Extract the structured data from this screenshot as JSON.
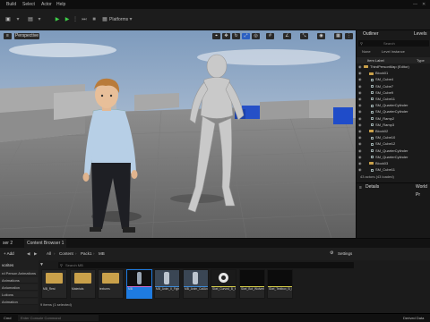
{
  "menu": {
    "items": [
      "Build",
      "Select",
      "Actor",
      "Help"
    ]
  },
  "toolbar": {
    "platforms_label": "Platforms"
  },
  "viewport": {
    "label": "Perspective"
  },
  "outliner": {
    "tab_outliner": "Outliner",
    "tab_levels": "Levels",
    "search_placeholder": "Search",
    "col_item_label": "Item Label",
    "col_type": "Type",
    "filter_none": "None",
    "filter_level": "Level Instance",
    "rows": [
      "ThirdPersonMap (Editor)",
      "Block01",
      "SM_Cube4",
      "SM_Cube7",
      "SM_Cube9",
      "SM_Cube11",
      "SM_QuarterCylinder",
      "SM_QuarterCylinder",
      "SM_Ramp2",
      "SM_Ramp3",
      "Block02",
      "SM_Cube10",
      "SM_Cube12",
      "SM_QuarterCylinder",
      "SM_QuarterCylinder",
      "Block03",
      "SM_Cube11"
    ],
    "status": "43 actors (43 loaded)"
  },
  "details": {
    "tab_details": "Details",
    "tab_world": "World Pr"
  },
  "content_browser": {
    "tab_drawer": "ser 2",
    "tab_main": "Content Browser 1",
    "add_label": "+ Add",
    "import_label": "Import",
    "save_label": "Save All",
    "breadcrumb": [
      "All",
      "Content",
      "Pack1",
      "MB"
    ],
    "settings_label": "Settings",
    "search_placeholder": "Search MB",
    "favorites_label": "vorites",
    "side_items": [
      "rd Person Animations",
      "Animations",
      "Aniumation",
      "Lutions",
      "Animation"
    ],
    "item_count": "9 items (1 selected)",
    "assets": [
      {
        "label": "MB_Rest",
        "type": "folder"
      },
      {
        "label": "Materials",
        "type": "folder"
      },
      {
        "label": "textures",
        "type": "folder"
      },
      {
        "label": "MB",
        "type": "character"
      },
      {
        "label": "MB_Anim_II_Fight_A_001",
        "type": "anim"
      },
      {
        "label": "MB_Anim_CallAnimal",
        "type": "anim"
      },
      {
        "label": "Skel_Curved_B_MB.opq_MB",
        "type": "sphere"
      },
      {
        "label": "Skel_Bot_Wolverine_MB_Pose",
        "type": "skel"
      },
      {
        "label": "Skel_Textbox_B_MB.opq_wolf",
        "type": "skel"
      }
    ]
  },
  "statusbar": {
    "drawer": "Content Drawer",
    "output": "Output Log",
    "cmd": "Cmd",
    "console_placeholder": "Enter Console Command",
    "derived": "Derived Data"
  }
}
